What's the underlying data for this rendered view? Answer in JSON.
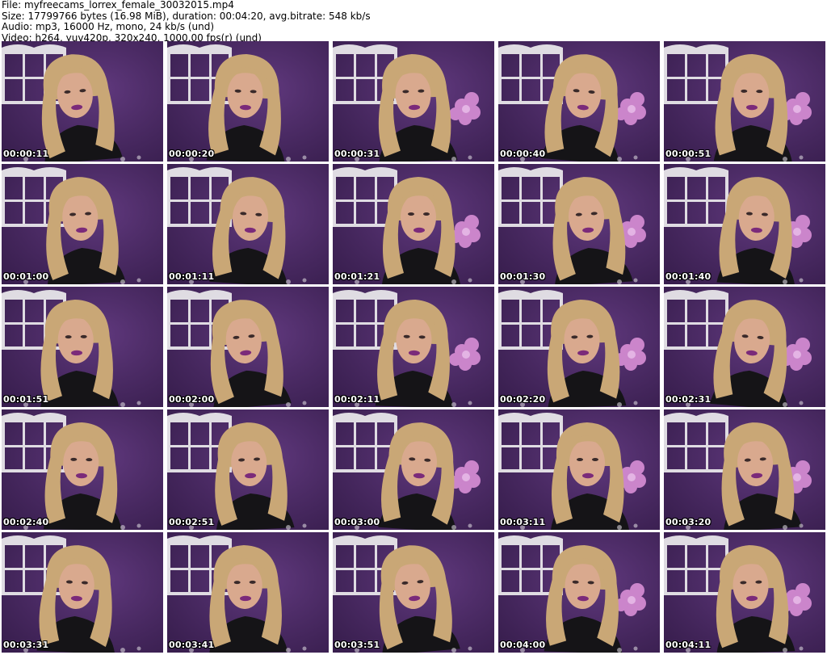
{
  "header": {
    "file_line": "File: myfreecams_lorrex_female_30032015.mp4",
    "size_line": "Size: 17799766 bytes (16.98 MiB), duration: 00:04:20, avg.bitrate: 548 kb/s",
    "audio_line": "Audio: mp3, 16000 Hz, mono, 24 kb/s (und)",
    "video_line": "Video: h264, yuv420p, 320x240, 1000.00 fps(r) (und)"
  },
  "thumbnails": [
    {
      "timestamp": "00:00:11"
    },
    {
      "timestamp": "00:00:20"
    },
    {
      "timestamp": "00:00:31"
    },
    {
      "timestamp": "00:00:40"
    },
    {
      "timestamp": "00:00:51"
    },
    {
      "timestamp": "00:01:00"
    },
    {
      "timestamp": "00:01:11"
    },
    {
      "timestamp": "00:01:21"
    },
    {
      "timestamp": "00:01:30"
    },
    {
      "timestamp": "00:01:40"
    },
    {
      "timestamp": "00:01:51"
    },
    {
      "timestamp": "00:02:00"
    },
    {
      "timestamp": "00:02:11"
    },
    {
      "timestamp": "00:02:20"
    },
    {
      "timestamp": "00:02:31"
    },
    {
      "timestamp": "00:02:40"
    },
    {
      "timestamp": "00:02:51"
    },
    {
      "timestamp": "00:03:00"
    },
    {
      "timestamp": "00:03:11"
    },
    {
      "timestamp": "00:03:20"
    },
    {
      "timestamp": "00:03:31"
    },
    {
      "timestamp": "00:03:41"
    },
    {
      "timestamp": "00:03:51"
    },
    {
      "timestamp": "00:04:00"
    },
    {
      "timestamp": "00:04:11"
    }
  ],
  "colors": {
    "wall": "#4a2a62",
    "shelf": "#e8e6ea",
    "hair": "#c9a776",
    "skin": "#d9a98e",
    "shirt": "#151417",
    "lips": "#7b2a7a",
    "flower": "#d98fd6"
  }
}
